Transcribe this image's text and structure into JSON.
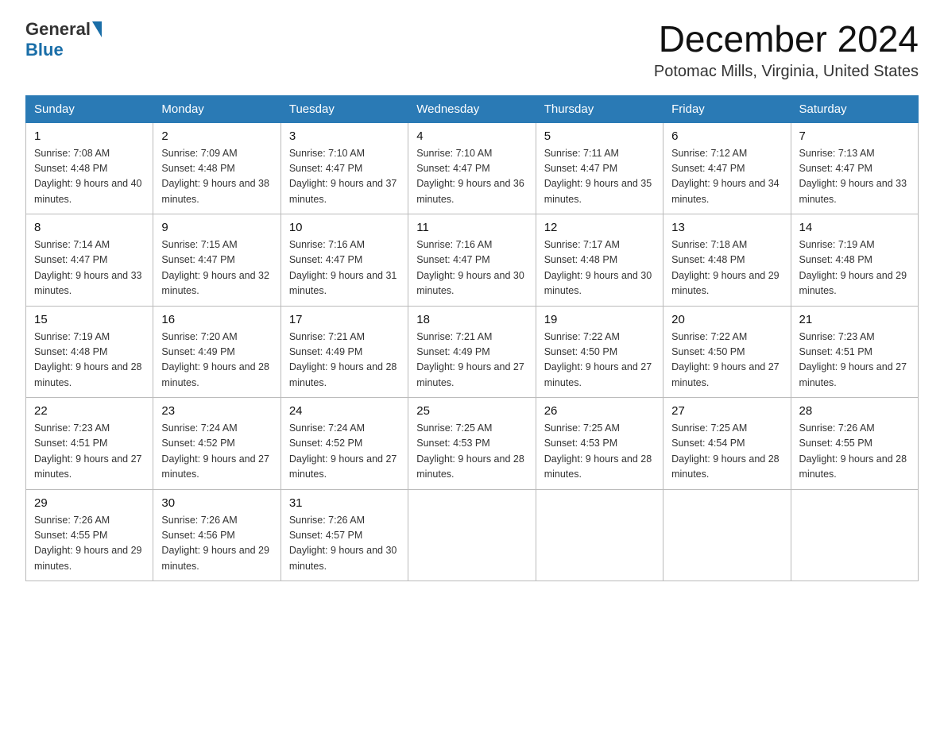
{
  "header": {
    "logo_general": "General",
    "logo_blue": "Blue",
    "month_title": "December 2024",
    "location": "Potomac Mills, Virginia, United States"
  },
  "weekdays": [
    "Sunday",
    "Monday",
    "Tuesday",
    "Wednesday",
    "Thursday",
    "Friday",
    "Saturday"
  ],
  "weeks": [
    [
      {
        "day": "1",
        "sunrise": "7:08 AM",
        "sunset": "4:48 PM",
        "daylight": "9 hours and 40 minutes."
      },
      {
        "day": "2",
        "sunrise": "7:09 AM",
        "sunset": "4:48 PM",
        "daylight": "9 hours and 38 minutes."
      },
      {
        "day": "3",
        "sunrise": "7:10 AM",
        "sunset": "4:47 PM",
        "daylight": "9 hours and 37 minutes."
      },
      {
        "day": "4",
        "sunrise": "7:10 AM",
        "sunset": "4:47 PM",
        "daylight": "9 hours and 36 minutes."
      },
      {
        "day": "5",
        "sunrise": "7:11 AM",
        "sunset": "4:47 PM",
        "daylight": "9 hours and 35 minutes."
      },
      {
        "day": "6",
        "sunrise": "7:12 AM",
        "sunset": "4:47 PM",
        "daylight": "9 hours and 34 minutes."
      },
      {
        "day": "7",
        "sunrise": "7:13 AM",
        "sunset": "4:47 PM",
        "daylight": "9 hours and 33 minutes."
      }
    ],
    [
      {
        "day": "8",
        "sunrise": "7:14 AM",
        "sunset": "4:47 PM",
        "daylight": "9 hours and 33 minutes."
      },
      {
        "day": "9",
        "sunrise": "7:15 AM",
        "sunset": "4:47 PM",
        "daylight": "9 hours and 32 minutes."
      },
      {
        "day": "10",
        "sunrise": "7:16 AM",
        "sunset": "4:47 PM",
        "daylight": "9 hours and 31 minutes."
      },
      {
        "day": "11",
        "sunrise": "7:16 AM",
        "sunset": "4:47 PM",
        "daylight": "9 hours and 30 minutes."
      },
      {
        "day": "12",
        "sunrise": "7:17 AM",
        "sunset": "4:48 PM",
        "daylight": "9 hours and 30 minutes."
      },
      {
        "day": "13",
        "sunrise": "7:18 AM",
        "sunset": "4:48 PM",
        "daylight": "9 hours and 29 minutes."
      },
      {
        "day": "14",
        "sunrise": "7:19 AM",
        "sunset": "4:48 PM",
        "daylight": "9 hours and 29 minutes."
      }
    ],
    [
      {
        "day": "15",
        "sunrise": "7:19 AM",
        "sunset": "4:48 PM",
        "daylight": "9 hours and 28 minutes."
      },
      {
        "day": "16",
        "sunrise": "7:20 AM",
        "sunset": "4:49 PM",
        "daylight": "9 hours and 28 minutes."
      },
      {
        "day": "17",
        "sunrise": "7:21 AM",
        "sunset": "4:49 PM",
        "daylight": "9 hours and 28 minutes."
      },
      {
        "day": "18",
        "sunrise": "7:21 AM",
        "sunset": "4:49 PM",
        "daylight": "9 hours and 27 minutes."
      },
      {
        "day": "19",
        "sunrise": "7:22 AM",
        "sunset": "4:50 PM",
        "daylight": "9 hours and 27 minutes."
      },
      {
        "day": "20",
        "sunrise": "7:22 AM",
        "sunset": "4:50 PM",
        "daylight": "9 hours and 27 minutes."
      },
      {
        "day": "21",
        "sunrise": "7:23 AM",
        "sunset": "4:51 PM",
        "daylight": "9 hours and 27 minutes."
      }
    ],
    [
      {
        "day": "22",
        "sunrise": "7:23 AM",
        "sunset": "4:51 PM",
        "daylight": "9 hours and 27 minutes."
      },
      {
        "day": "23",
        "sunrise": "7:24 AM",
        "sunset": "4:52 PM",
        "daylight": "9 hours and 27 minutes."
      },
      {
        "day": "24",
        "sunrise": "7:24 AM",
        "sunset": "4:52 PM",
        "daylight": "9 hours and 27 minutes."
      },
      {
        "day": "25",
        "sunrise": "7:25 AM",
        "sunset": "4:53 PM",
        "daylight": "9 hours and 28 minutes."
      },
      {
        "day": "26",
        "sunrise": "7:25 AM",
        "sunset": "4:53 PM",
        "daylight": "9 hours and 28 minutes."
      },
      {
        "day": "27",
        "sunrise": "7:25 AM",
        "sunset": "4:54 PM",
        "daylight": "9 hours and 28 minutes."
      },
      {
        "day": "28",
        "sunrise": "7:26 AM",
        "sunset": "4:55 PM",
        "daylight": "9 hours and 28 minutes."
      }
    ],
    [
      {
        "day": "29",
        "sunrise": "7:26 AM",
        "sunset": "4:55 PM",
        "daylight": "9 hours and 29 minutes."
      },
      {
        "day": "30",
        "sunrise": "7:26 AM",
        "sunset": "4:56 PM",
        "daylight": "9 hours and 29 minutes."
      },
      {
        "day": "31",
        "sunrise": "7:26 AM",
        "sunset": "4:57 PM",
        "daylight": "9 hours and 30 minutes."
      },
      null,
      null,
      null,
      null
    ]
  ],
  "labels": {
    "sunrise": "Sunrise: ",
    "sunset": "Sunset: ",
    "daylight": "Daylight: "
  }
}
